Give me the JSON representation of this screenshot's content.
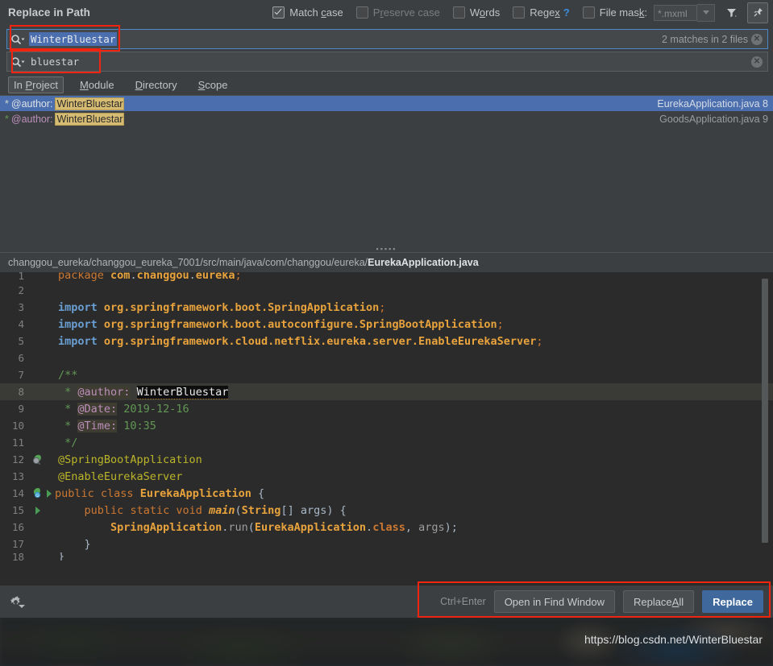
{
  "header": {
    "title": "Replace in Path",
    "options": [
      {
        "label_pre": "Match ",
        "label_u": "c",
        "label_post": "ase",
        "checked": true,
        "dim": false
      },
      {
        "label_pre": "P",
        "label_u": "r",
        "label_post": "eserve case",
        "checked": false,
        "dim": true
      },
      {
        "label_pre": "W",
        "label_u": "o",
        "label_post": "rds",
        "checked": false,
        "dim": false
      },
      {
        "label_pre": "Rege",
        "label_u": "x",
        "label_post": "",
        "checked": false,
        "dim": false
      }
    ],
    "regex_help": "?",
    "file_mask": {
      "label_pre": "File mas",
      "label_u": "k",
      "label_post": ":",
      "checked": false,
      "value": "*.mxml"
    },
    "filter_icon": "filter-icon",
    "pin_icon": "pin-icon"
  },
  "search": {
    "find_value": "WinterBluestar",
    "find_match_info": "2 matches in 2 files",
    "replace_value": "bluestar",
    "search_icon": "search-icon",
    "clear_icon": "clear-icon"
  },
  "scope": {
    "buttons": [
      {
        "pre": "In ",
        "u": "P",
        "post": "roject",
        "active": true
      },
      {
        "pre": "",
        "u": "M",
        "post": "odule",
        "active": false
      },
      {
        "pre": "",
        "u": "D",
        "post": "irectory",
        "active": false
      },
      {
        "pre": "",
        "u": "S",
        "post": "cope",
        "active": false
      }
    ]
  },
  "results": {
    "rows": [
      {
        "star": "*",
        "tag": "@author:",
        "hit": "WinterBluestar",
        "file": "EurekaApplication.java",
        "line": "8",
        "selected": true
      },
      {
        "star": "*",
        "tag": "@author:",
        "hit": "WinterBluestar",
        "file": "GoodsApplication.java",
        "line": "9",
        "selected": false
      }
    ]
  },
  "preview": {
    "path_prefix": "changgou_eureka/changgou_eureka_7001/src/main/java/com/changgou/eureka/",
    "path_file": "EurekaApplication.java",
    "lines": [
      {
        "n": "1",
        "text": "package com.changgou.eureka;"
      },
      {
        "n": "2",
        "text": ""
      },
      {
        "n": "3",
        "text": "import org.springframework.boot.SpringApplication;"
      },
      {
        "n": "4",
        "text": "import org.springframework.boot.autoconfigure.SpringBootApplication;"
      },
      {
        "n": "5",
        "text": "import org.springframework.cloud.netflix.eureka.server.EnableEurekaServer;"
      },
      {
        "n": "6",
        "text": ""
      },
      {
        "n": "7",
        "text": "/**"
      },
      {
        "n": "8",
        "text": " * @author: WinterBluestar"
      },
      {
        "n": "9",
        "text": " * @Date: 2019-12-16"
      },
      {
        "n": "10",
        "text": " * @Time: 10:35"
      },
      {
        "n": "11",
        "text": " */"
      },
      {
        "n": "12",
        "text": "@SpringBootApplication"
      },
      {
        "n": "13",
        "text": "@EnableEurekaServer"
      },
      {
        "n": "14",
        "text": "public class EurekaApplication {"
      },
      {
        "n": "15",
        "text": "    public static void main(String[] args) {"
      },
      {
        "n": "16",
        "text": "        SpringApplication.run(EurekaApplication.class, args);"
      },
      {
        "n": "17",
        "text": "    }"
      },
      {
        "n": "18",
        "text": "}"
      }
    ]
  },
  "footer": {
    "settings_icon": "gear-icon",
    "shortcut": "Ctrl+Enter",
    "open_find_window": "Open in Find Window",
    "replace_all_pre": "Replace ",
    "replace_all_u": "A",
    "replace_all_post": "ll",
    "replace": "Replace"
  },
  "watermark": "https://blog.csdn.net/WinterBluestar",
  "colors": {
    "accent_blue": "#4b6eaf",
    "primary_button": "#3f699c",
    "highlight_yellow": "#d6bb72",
    "annotation_red": "#f0240f",
    "panel_bg": "#3c3f41",
    "editor_bg": "#2b2b2b"
  }
}
